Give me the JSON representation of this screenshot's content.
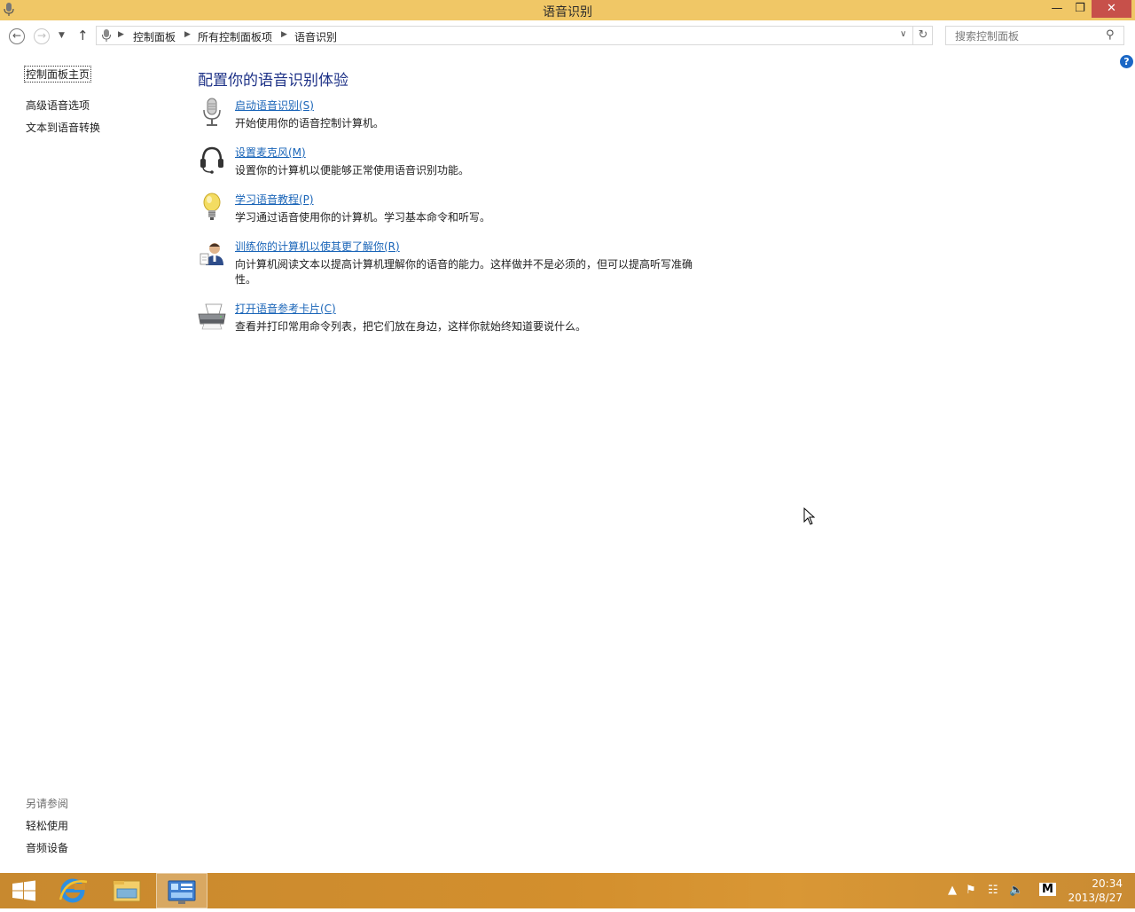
{
  "window": {
    "title": "语音识别"
  },
  "navigation": {
    "breadcrumbs": [
      "控制面板",
      "所有控制面板项",
      "语音识别"
    ],
    "search_placeholder": "搜索控制面板"
  },
  "sidebar": {
    "home": "控制面板主页",
    "items": [
      "高级语音选项",
      "文本到语音转换"
    ],
    "see_also_title": "另请参阅",
    "see_also": [
      "轻松使用",
      "音频设备"
    ]
  },
  "main": {
    "title": "配置你的语音识别体验",
    "items": [
      {
        "label": "启动语音识别(S)",
        "description": "开始使用你的语音控制计算机。",
        "icon": "microphone-icon"
      },
      {
        "label": "设置麦克风(M)",
        "description": "设置你的计算机以便能够正常使用语音识别功能。",
        "icon": "headset-icon"
      },
      {
        "label": "学习语音教程(P)",
        "description": "学习通过语音使用你的计算机。学习基本命令和听写。",
        "icon": "lightbulb-icon"
      },
      {
        "label": "训练你的计算机以使其更了解你(R)",
        "description": "向计算机阅读文本以提高计算机理解你的语音的能力。这样做并不是必须的，但可以提高听写准确性。",
        "icon": "user-train-icon"
      },
      {
        "label": "打开语音参考卡片(C)",
        "description": "查看并打印常用命令列表，把它们放在身边，这样你就始终知道要说什么。",
        "icon": "printer-icon"
      }
    ]
  },
  "taskbar": {
    "time": "20:34",
    "date": "2013/8/27",
    "ime": "M"
  }
}
